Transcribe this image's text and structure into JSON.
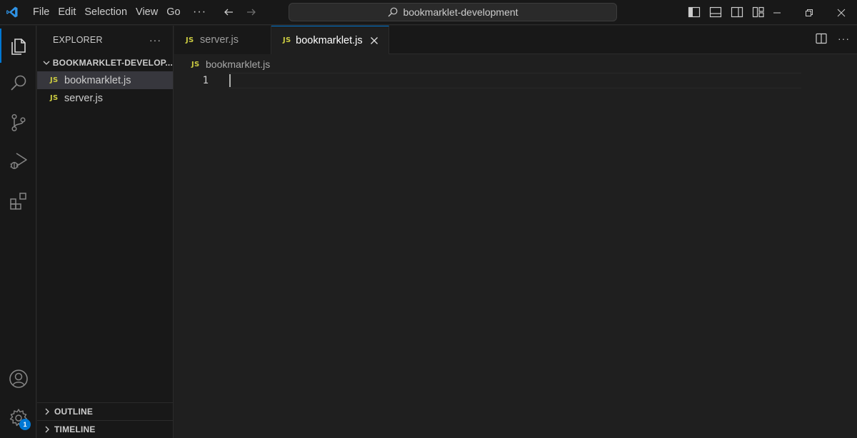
{
  "titlebar": {
    "menu": [
      "File",
      "Edit",
      "Selection",
      "View",
      "Go"
    ],
    "more": "···",
    "search_text": "bookmarklet-development"
  },
  "activity_bar": {
    "items": [
      "explorer",
      "search",
      "source-control",
      "run-and-debug",
      "extensions"
    ],
    "bottom": [
      "accounts",
      "manage"
    ],
    "manage_badge": "1",
    "accent": "#0078d4"
  },
  "sidebar": {
    "title": "EXPLORER",
    "more": "···",
    "folder": "BOOKMARKLET-DEVELOP...",
    "files": [
      {
        "icon": "JS",
        "name": "bookmarklet.js",
        "selected": true
      },
      {
        "icon": "JS",
        "name": "server.js",
        "selected": false
      }
    ],
    "sections": [
      "OUTLINE",
      "TIMELINE"
    ]
  },
  "tabs": [
    {
      "icon": "JS",
      "label": "server.js",
      "active": false
    },
    {
      "icon": "JS",
      "label": "bookmarklet.js",
      "active": true
    }
  ],
  "breadcrumb": {
    "icon": "JS",
    "file": "bookmarklet.js"
  },
  "editor": {
    "line_numbers": [
      "1"
    ],
    "more": "···"
  },
  "colors": {
    "background": "#1f1f1f",
    "chrome": "#181818",
    "js_icon": "#cbcb41",
    "vscode_logo": "#0078d4"
  }
}
